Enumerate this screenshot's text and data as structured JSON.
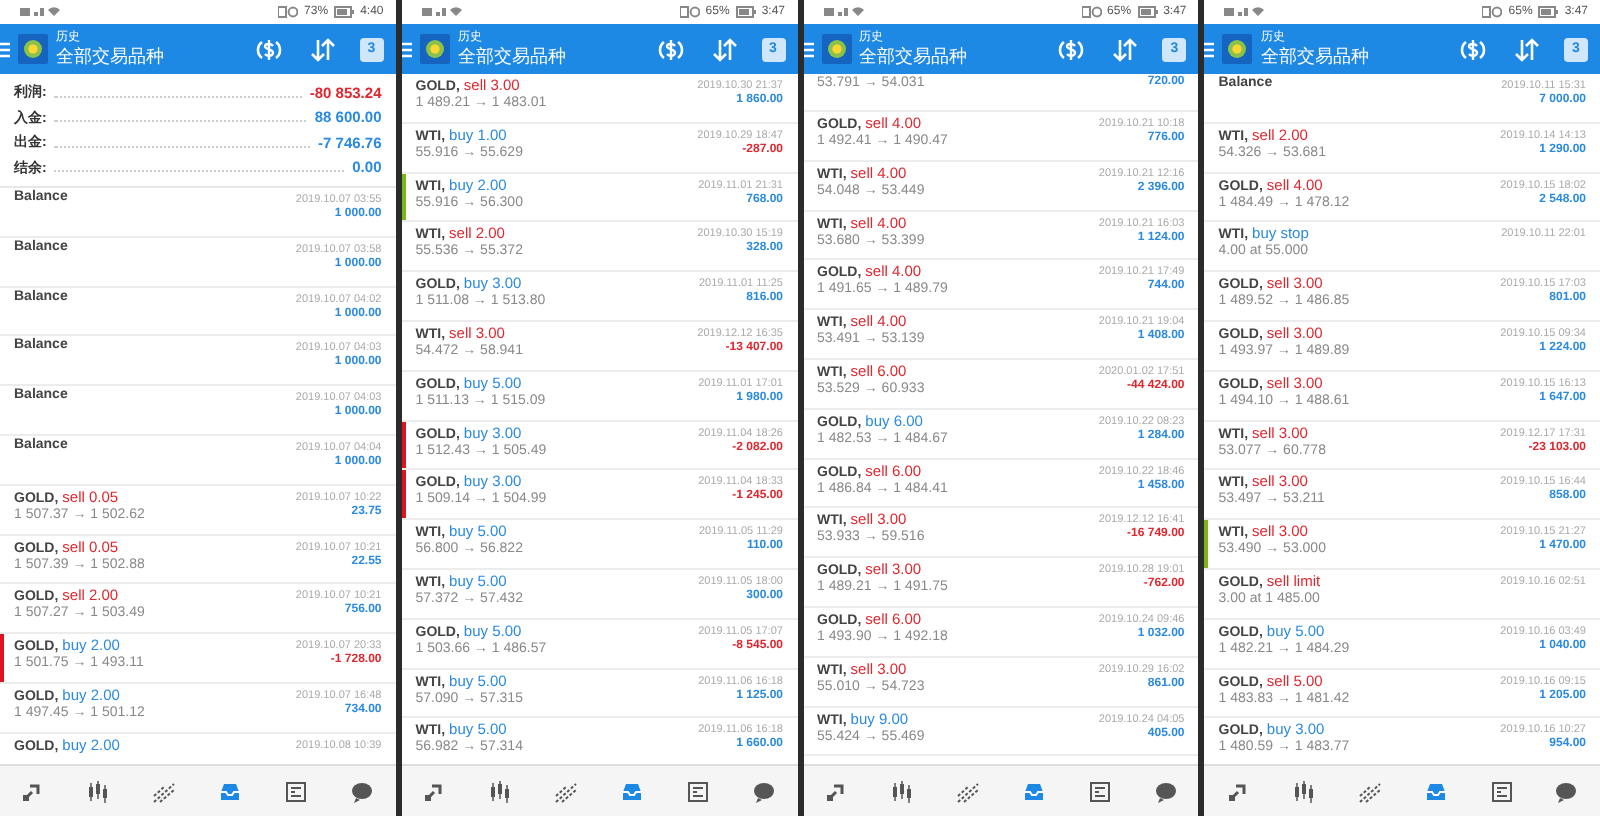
{
  "panels": [
    {
      "status": {
        "battery": "73%",
        "time": "4:40"
      },
      "header": {
        "title": "历史",
        "subtitle": "全部交易品种",
        "calendar": "3"
      },
      "summary": [
        {
          "label": "利润:",
          "value": "-80 853.24",
          "color": "#e0262e"
        },
        {
          "label": "入金:",
          "value": "88 600.00",
          "color": "#2a8ae0"
        },
        {
          "label": "出金:",
          "value": "-7 746.76",
          "color": "#2a8ae0"
        },
        {
          "label": "结余:",
          "value": "0.00",
          "color": "#2a8ae0"
        }
      ],
      "rows": [
        {
          "kind": "balance",
          "title": "Balance",
          "time": "2019.10.07 03:55",
          "profit": "1 000.00",
          "loss": false
        },
        {
          "kind": "balance",
          "title": "Balance",
          "time": "2019.10.07 03:58",
          "profit": "1 000.00",
          "loss": false
        },
        {
          "kind": "balance",
          "title": "Balance",
          "time": "2019.10.07 04:02",
          "profit": "1 000.00",
          "loss": false
        },
        {
          "kind": "balance",
          "title": "Balance",
          "time": "2019.10.07 04:03",
          "profit": "1 000.00",
          "loss": false
        },
        {
          "kind": "balance",
          "title": "Balance",
          "time": "2019.10.07 04:03",
          "profit": "1 000.00",
          "loss": false
        },
        {
          "kind": "balance",
          "title": "Balance",
          "time": "2019.10.07 04:04",
          "profit": "1 000.00",
          "loss": false
        },
        {
          "kind": "trade",
          "symbol": "GOLD,",
          "action": "sell 0.05",
          "sell": true,
          "prices": "1 507.37 → 1 502.62",
          "time": "2019.10.07 10:22",
          "profit": "23.75",
          "loss": false
        },
        {
          "kind": "trade",
          "symbol": "GOLD,",
          "action": "sell 0.05",
          "sell": true,
          "prices": "1 507.39 → 1 502.88",
          "time": "2019.10.07 10:21",
          "profit": "22.55",
          "loss": false
        },
        {
          "kind": "trade",
          "symbol": "GOLD,",
          "action": "sell 2.00",
          "sell": true,
          "prices": "1 507.27 → 1 503.49",
          "time": "2019.10.07 10:21",
          "profit": "756.00",
          "loss": false
        },
        {
          "kind": "trade",
          "symbol": "GOLD,",
          "action": "buy 2.00",
          "sell": false,
          "prices": "1 501.75 → 1 493.11",
          "time": "2019.10.07 20:33",
          "profit": "-1 728.00",
          "loss": true,
          "color": "#e0141e"
        },
        {
          "kind": "trade",
          "symbol": "GOLD,",
          "action": "buy 2.00",
          "sell": false,
          "prices": "1 497.45 → 1 501.12",
          "time": "2019.10.07 16:48",
          "profit": "734.00",
          "loss": false
        },
        {
          "kind": "trade",
          "symbol": "GOLD,",
          "action": "buy 2.00",
          "sell": false,
          "time": "2019.10.08 10:39"
        }
      ]
    },
    {
      "status": {
        "battery": "65%",
        "time": "3:47"
      },
      "header": {
        "title": "历史",
        "subtitle": "全部交易品种",
        "calendar": "3"
      },
      "rows": [
        {
          "kind": "trade",
          "symbol": "GOLD,",
          "action": "sell 3.00",
          "sell": true,
          "prices": "1 489.21 → 1 483.01",
          "time": "2019.10.30 21:37",
          "profit": "1 860.00",
          "loss": false
        },
        {
          "kind": "trade",
          "symbol": "WTI,",
          "action": "buy 1.00",
          "sell": false,
          "prices": "55.916 → 55.629",
          "time": "2019.10.29 18:47",
          "profit": "-287.00",
          "loss": true
        },
        {
          "kind": "trade",
          "symbol": "WTI,",
          "action": "buy 2.00",
          "sell": false,
          "prices": "55.916 → 56.300",
          "time": "2019.11.01 21:31",
          "profit": "768.00",
          "loss": false,
          "color": "#7cb518"
        },
        {
          "kind": "trade",
          "symbol": "WTI,",
          "action": "sell 2.00",
          "sell": true,
          "prices": "55.536 → 55.372",
          "time": "2019.10.30 15:19",
          "profit": "328.00",
          "loss": false
        },
        {
          "kind": "trade",
          "symbol": "GOLD,",
          "action": "buy 3.00",
          "sell": false,
          "prices": "1 511.08 → 1 513.80",
          "time": "2019.11.01 11:25",
          "profit": "816.00",
          "loss": false
        },
        {
          "kind": "trade",
          "symbol": "WTI,",
          "action": "sell 3.00",
          "sell": true,
          "prices": "54.472 → 58.941",
          "time": "2019.12.12 16:35",
          "profit": "-13 407.00",
          "loss": true
        },
        {
          "kind": "trade",
          "symbol": "GOLD,",
          "action": "buy 5.00",
          "sell": false,
          "prices": "1 511.13 → 1 515.09",
          "time": "2019.11.01 17:01",
          "profit": "1 980.00",
          "loss": false
        },
        {
          "kind": "trade",
          "symbol": "GOLD,",
          "action": "buy 3.00",
          "sell": false,
          "prices": "1 512.43 → 1 505.49",
          "time": "2019.11.04 18:26",
          "profit": "-2 082.00",
          "loss": true,
          "color": "#e0141e"
        },
        {
          "kind": "trade",
          "symbol": "GOLD,",
          "action": "buy 3.00",
          "sell": false,
          "prices": "1 509.14 → 1 504.99",
          "time": "2019.11.04 18:33",
          "profit": "-1 245.00",
          "loss": true,
          "color": "#e0141e"
        },
        {
          "kind": "trade",
          "symbol": "WTI,",
          "action": "buy 5.00",
          "sell": false,
          "prices": "56.800 → 56.822",
          "time": "2019.11.05 11:29",
          "profit": "110.00",
          "loss": false
        },
        {
          "kind": "trade",
          "symbol": "WTI,",
          "action": "buy 5.00",
          "sell": false,
          "prices": "57.372 → 57.432",
          "time": "2019.11.05 18:00",
          "profit": "300.00",
          "loss": false
        },
        {
          "kind": "trade",
          "symbol": "GOLD,",
          "action": "buy 5.00",
          "sell": false,
          "prices": "1 503.66 → 1 486.57",
          "time": "2019.11.05 17:07",
          "profit": "-8 545.00",
          "loss": true
        },
        {
          "kind": "trade",
          "symbol": "WTI,",
          "action": "buy 5.00",
          "sell": false,
          "prices": "57.090 → 57.315",
          "time": "2019.11.06 16:18",
          "profit": "1 125.00",
          "loss": false
        },
        {
          "kind": "trade",
          "symbol": "WTI,",
          "action": "buy 5.00",
          "sell": false,
          "prices": "56.982 → 57.314",
          "time": "2019.11.06 16:18",
          "profit": "1 660.00",
          "loss": false
        }
      ]
    },
    {
      "status": {
        "battery": "65%",
        "time": "3:47"
      },
      "header": {
        "title": "历史",
        "subtitle": "全部交易品种",
        "calendar": "3"
      },
      "rows": [
        {
          "kind": "partial",
          "prices": "53.791 → 54.031",
          "profit": "720.00",
          "loss": false
        },
        {
          "kind": "trade",
          "symbol": "GOLD,",
          "action": "sell 4.00",
          "sell": true,
          "prices": "1 492.41 → 1 490.47",
          "time": "2019.10.21 10:18",
          "profit": "776.00",
          "loss": false
        },
        {
          "kind": "trade",
          "symbol": "WTI,",
          "action": "sell 4.00",
          "sell": true,
          "prices": "54.048 → 53.449",
          "time": "2019.10.21 12:16",
          "profit": "2 396.00",
          "loss": false
        },
        {
          "kind": "trade",
          "symbol": "WTI,",
          "action": "sell 4.00",
          "sell": true,
          "prices": "53.680 → 53.399",
          "time": "2019.10.21 16:03",
          "profit": "1 124.00",
          "loss": false
        },
        {
          "kind": "trade",
          "symbol": "GOLD,",
          "action": "sell 4.00",
          "sell": true,
          "prices": "1 491.65 → 1 489.79",
          "time": "2019.10.21 17:49",
          "profit": "744.00",
          "loss": false
        },
        {
          "kind": "trade",
          "symbol": "WTI,",
          "action": "sell 4.00",
          "sell": true,
          "prices": "53.491 → 53.139",
          "time": "2019.10.21 19:04",
          "profit": "1 408.00",
          "loss": false
        },
        {
          "kind": "trade",
          "symbol": "WTI,",
          "action": "sell 6.00",
          "sell": true,
          "prices": "53.529 → 60.933",
          "time": "2020.01.02 17:51",
          "profit": "-44 424.00",
          "loss": true
        },
        {
          "kind": "trade",
          "symbol": "GOLD,",
          "action": "buy 6.00",
          "sell": false,
          "prices": "1 482.53 → 1 484.67",
          "time": "2019.10.22 08:23",
          "profit": "1 284.00",
          "loss": false
        },
        {
          "kind": "trade",
          "symbol": "GOLD,",
          "action": "sell 6.00",
          "sell": true,
          "prices": "1 486.84 → 1 484.41",
          "time": "2019.10.22 18:46",
          "profit": "1 458.00",
          "loss": false
        },
        {
          "kind": "trade",
          "symbol": "WTI,",
          "action": "sell 3.00",
          "sell": true,
          "prices": "53.933 → 59.516",
          "time": "2019.12.12 16:41",
          "profit": "-16 749.00",
          "loss": true
        },
        {
          "kind": "trade",
          "symbol": "GOLD,",
          "action": "sell 3.00",
          "sell": true,
          "prices": "1 489.21 → 1 491.75",
          "time": "2019.10.28 19:01",
          "profit": "-762.00",
          "loss": true
        },
        {
          "kind": "trade",
          "symbol": "GOLD,",
          "action": "sell 6.00",
          "sell": true,
          "prices": "1 493.90 → 1 492.18",
          "time": "2019.10.24 09:46",
          "profit": "1 032.00",
          "loss": false
        },
        {
          "kind": "trade",
          "symbol": "WTI,",
          "action": "sell 3.00",
          "sell": true,
          "prices": "55.010 → 54.723",
          "time": "2019.10.29 16:02",
          "profit": "861.00",
          "loss": false
        },
        {
          "kind": "trade",
          "symbol": "WTI,",
          "action": "buy 9.00",
          "sell": false,
          "prices": "55.424 → 55.469",
          "time": "2019.10.24 04:05",
          "profit": "405.00",
          "loss": false
        }
      ]
    },
    {
      "status": {
        "battery": "65%",
        "time": "3:47"
      },
      "header": {
        "title": "历史",
        "subtitle": "全部交易品种",
        "calendar": "3"
      },
      "rows": [
        {
          "kind": "balance",
          "title": "Balance",
          "time": "2019.10.11 15:31",
          "profit": "7 000.00",
          "loss": false
        },
        {
          "kind": "trade",
          "symbol": "WTI,",
          "action": "sell 2.00",
          "sell": true,
          "prices": "54.326 → 53.681",
          "time": "2019.10.14 14:13",
          "profit": "1 290.00",
          "loss": false
        },
        {
          "kind": "trade",
          "symbol": "GOLD,",
          "action": "sell 4.00",
          "sell": true,
          "prices": "1 484.49 → 1 478.12",
          "time": "2019.10.15 18:02",
          "profit": "2 548.00",
          "loss": false
        },
        {
          "kind": "trade",
          "symbol": "WTI,",
          "action": "buy stop",
          "sell": false,
          "prices": "4.00 at 55.000",
          "time": "2019.10.11 22:01"
        },
        {
          "kind": "trade",
          "symbol": "GOLD,",
          "action": "sell 3.00",
          "sell": true,
          "prices": "1 489.52 → 1 486.85",
          "time": "2019.10.15 17:03",
          "profit": "801.00",
          "loss": false
        },
        {
          "kind": "trade",
          "symbol": "GOLD,",
          "action": "sell 3.00",
          "sell": true,
          "prices": "1 493.97 → 1 489.89",
          "time": "2019.10.15 09:34",
          "profit": "1 224.00",
          "loss": false
        },
        {
          "kind": "trade",
          "symbol": "GOLD,",
          "action": "sell 3.00",
          "sell": true,
          "prices": "1 494.10 → 1 488.61",
          "time": "2019.10.15 16:13",
          "profit": "1 647.00",
          "loss": false
        },
        {
          "kind": "trade",
          "symbol": "WTI,",
          "action": "sell 3.00",
          "sell": true,
          "prices": "53.077 → 60.778",
          "time": "2019.12.17 17:31",
          "profit": "-23 103.00",
          "loss": true
        },
        {
          "kind": "trade",
          "symbol": "WTI,",
          "action": "sell 3.00",
          "sell": true,
          "prices": "53.497 → 53.211",
          "time": "2019.10.15 16:44",
          "profit": "858.00",
          "loss": false
        },
        {
          "kind": "trade",
          "symbol": "WTI,",
          "action": "sell 3.00",
          "sell": true,
          "prices": "53.490 → 53.000",
          "time": "2019.10.15 21:27",
          "profit": "1 470.00",
          "loss": false,
          "color": "#7cb518"
        },
        {
          "kind": "trade",
          "symbol": "GOLD,",
          "action": "sell limit",
          "sell": true,
          "prices": "3.00 at 1 485.00",
          "time": "2019.10.16 02:51"
        },
        {
          "kind": "trade",
          "symbol": "GOLD,",
          "action": "buy 5.00",
          "sell": false,
          "prices": "1 482.21 → 1 484.29",
          "time": "2019.10.16 03:49",
          "profit": "1 040.00",
          "loss": false
        },
        {
          "kind": "trade",
          "symbol": "GOLD,",
          "action": "sell 5.00",
          "sell": true,
          "prices": "1 483.83 → 1 481.42",
          "time": "2019.10.16 09:15",
          "profit": "1 205.00",
          "loss": false
        },
        {
          "kind": "trade",
          "symbol": "GOLD,",
          "action": "buy 3.00",
          "sell": false,
          "prices": "1 480.59 → 1 483.77",
          "time": "2019.10.16 10:27",
          "profit": "954.00",
          "loss": false
        }
      ]
    }
  ],
  "nav": [
    {
      "selected": false
    },
    {
      "selected": false
    },
    {
      "selected": false
    },
    {
      "selected": true
    },
    {
      "selected": false
    },
    {
      "selected": false
    }
  ]
}
